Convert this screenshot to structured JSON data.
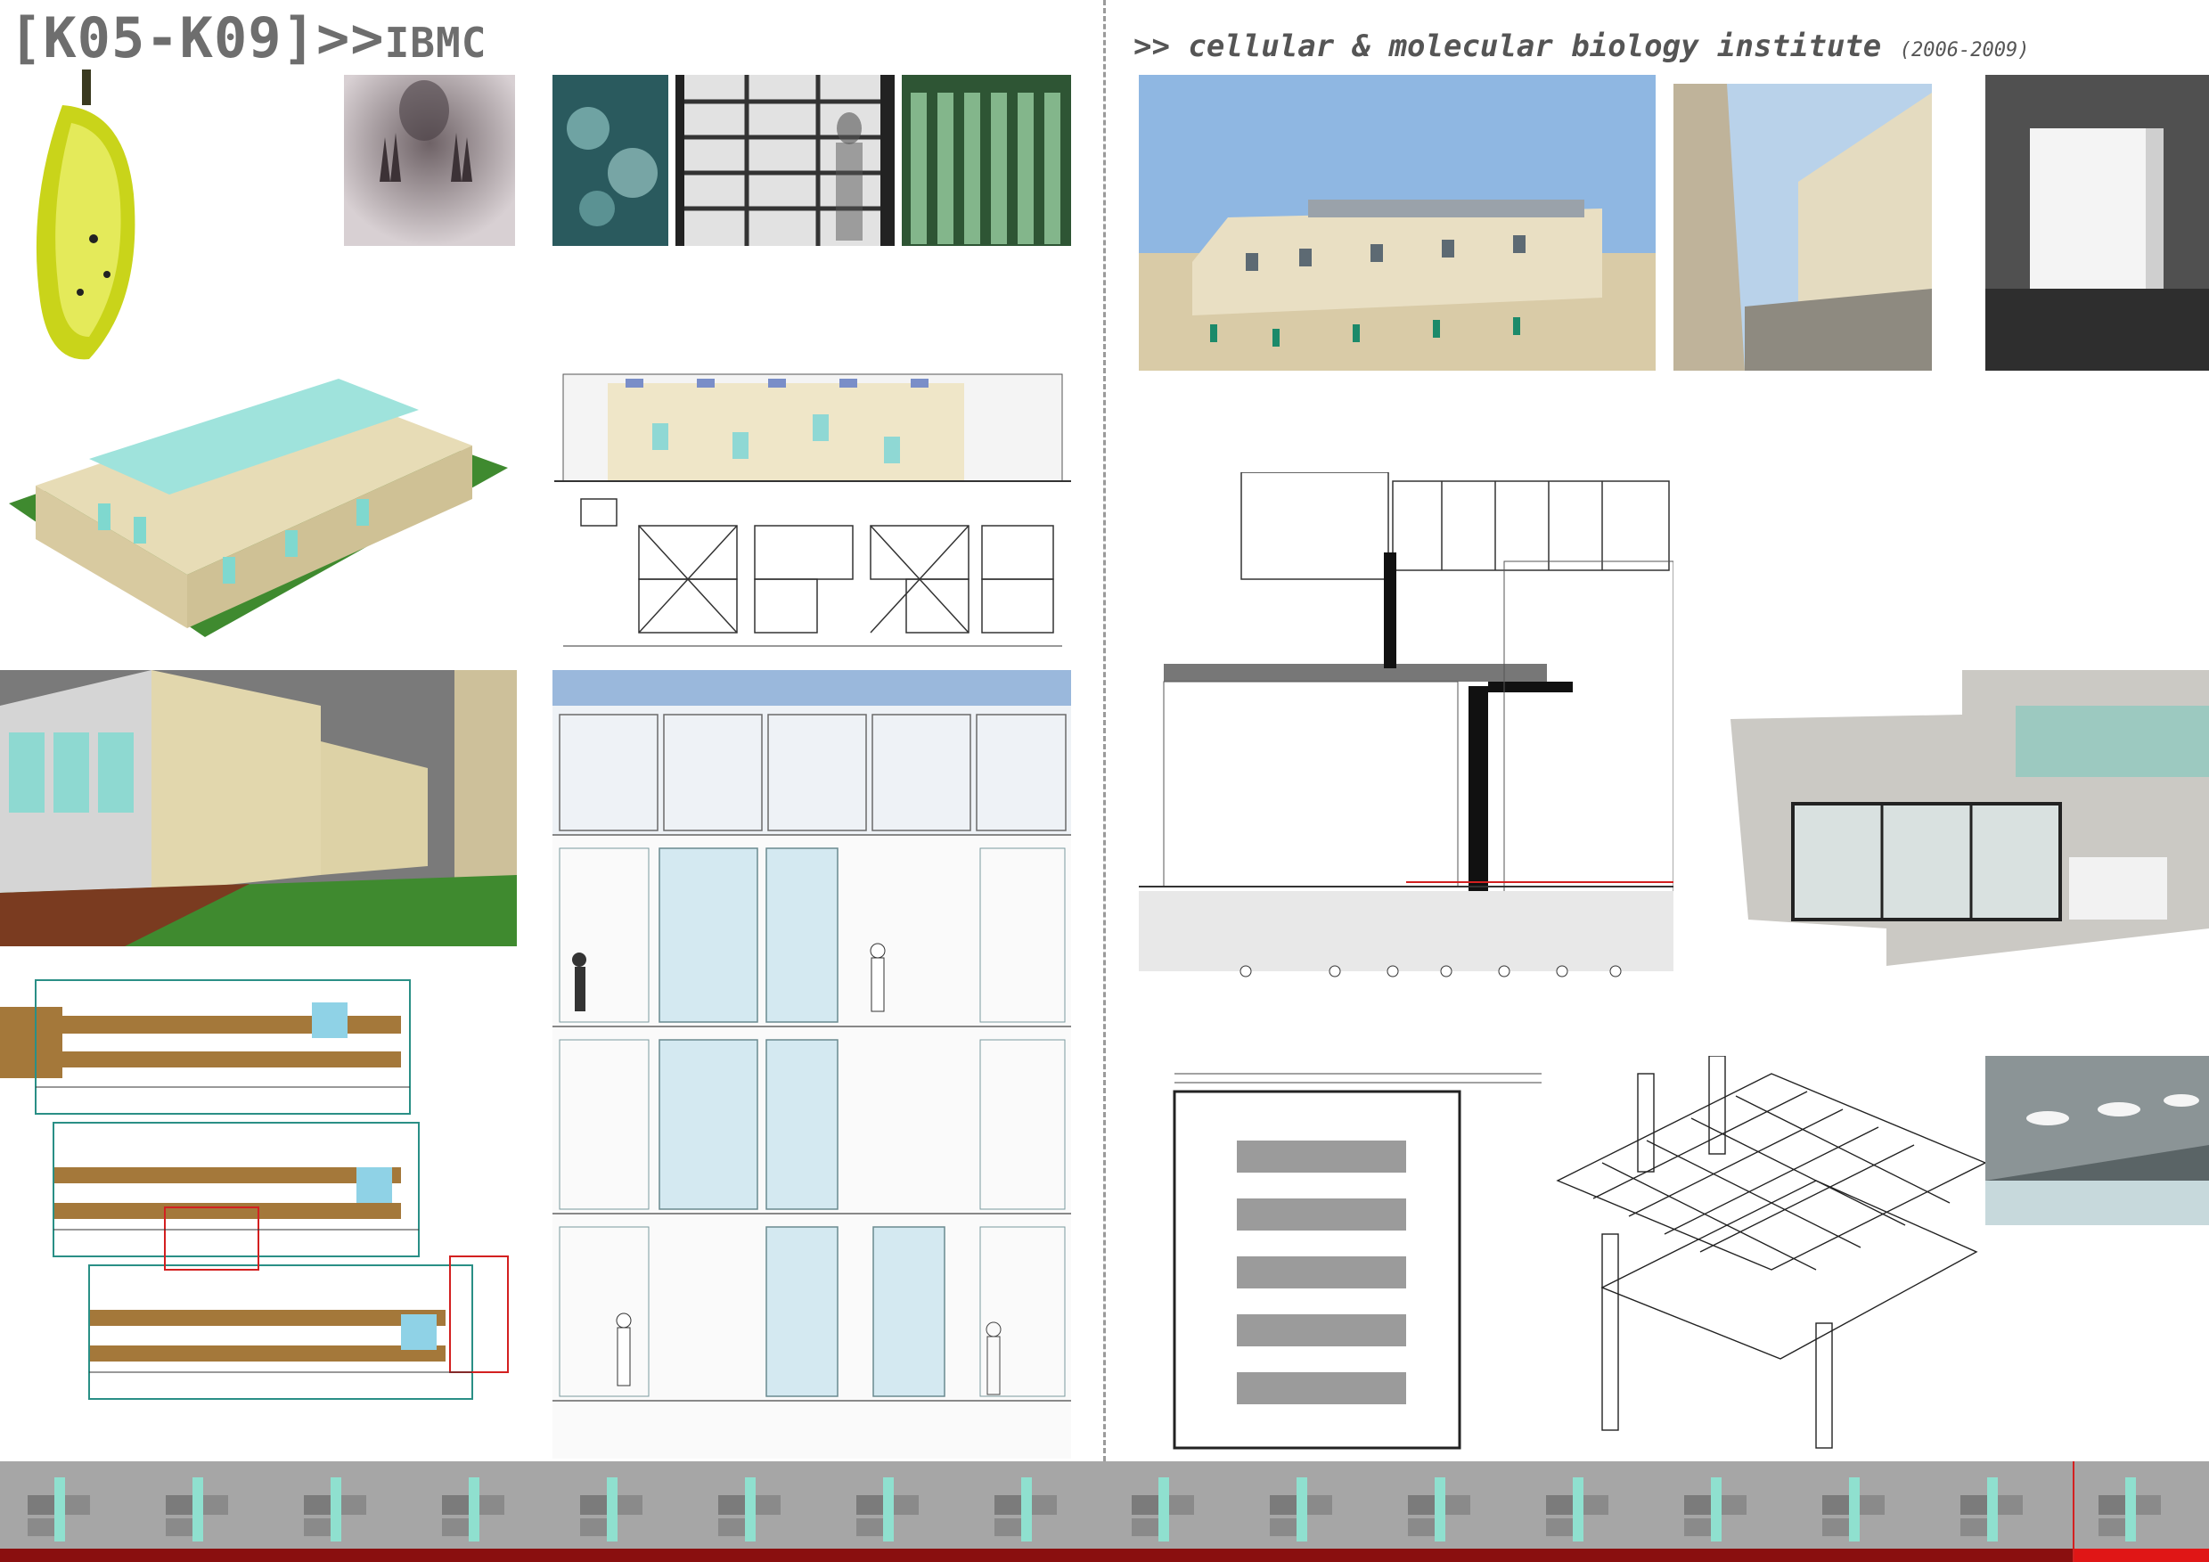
{
  "header": {
    "code": "[K05-K09]>>",
    "abbr": "IBMC",
    "project": ">> cellular & molecular biology institute",
    "years": "(2006-2009)"
  },
  "colors": {
    "accent_red": "#d32020",
    "dark_red": "#8a0f0f",
    "glass_cyan": "#7fd8cf",
    "stone": "#e6dcb8",
    "strip_gray": "#a6a6a6"
  },
  "panels": [
    {
      "name": "chrysalis-photo"
    },
    {
      "name": "hands-behind-glass-photo"
    },
    {
      "name": "jellyfish-photo"
    },
    {
      "name": "window-silhouette-photo"
    },
    {
      "name": "test-tubes-photo"
    },
    {
      "name": "exterior-photo"
    },
    {
      "name": "courtyard-photo"
    },
    {
      "name": "interior-window-photo"
    },
    {
      "name": "aerial-render"
    },
    {
      "name": "elevation-drawing"
    },
    {
      "name": "facade-module-diagram"
    },
    {
      "name": "courtyard-render"
    },
    {
      "name": "facade-elevation-render"
    },
    {
      "name": "floor-plan"
    },
    {
      "name": "wall-section-detail"
    },
    {
      "name": "lab-interior-photo"
    },
    {
      "name": "ceiling-plan"
    },
    {
      "name": "axonometric-structure"
    },
    {
      "name": "ceiling-photo"
    }
  ],
  "strip": {
    "thumbnail_count": 16
  }
}
